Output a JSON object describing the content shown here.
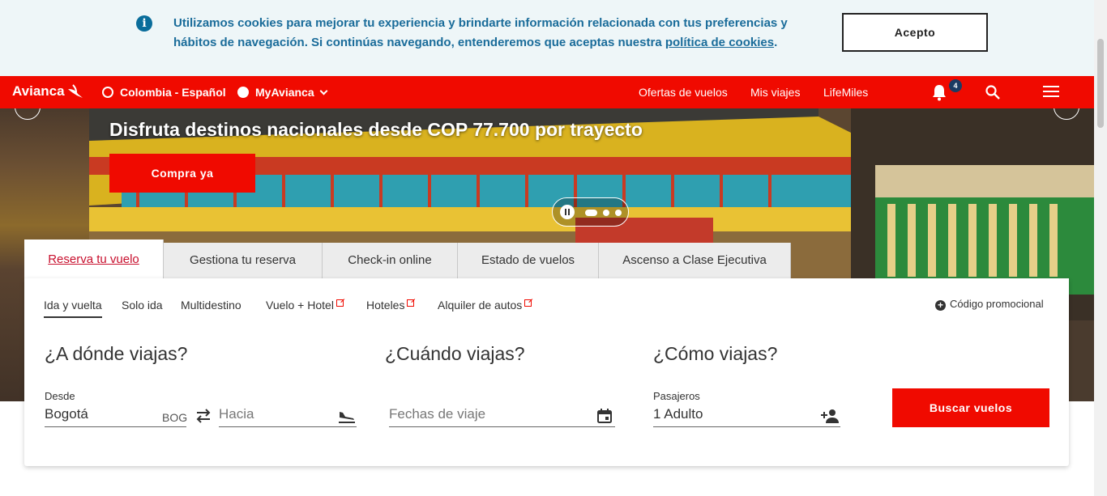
{
  "cookie": {
    "info_icon": "info-icon",
    "message_line1": "Utilizamos cookies para mejorar tu experiencia y brindarte información relacionada con tus preferencias y",
    "message_line2": "hábitos de navegación. Si continúas navegando, entenderemos que aceptas nuestra",
    "policy_link": "política de cookies",
    "period": ".",
    "accept_label": "Acepto"
  },
  "nav": {
    "logo": "Avianca",
    "country": "Colombia - Español",
    "account": "MyAvianca",
    "links": [
      "Ofertas de vuelos",
      "Mis viajes",
      "LifeMiles"
    ],
    "notification_count": "4",
    "brand_color": "#f00a00"
  },
  "hero": {
    "headline": "Disfruta destinos nacionales desde COP 77.700 por trayecto",
    "cta": "Compra ya",
    "slide_count": 3,
    "active_slide": 1
  },
  "tabs": [
    "Reserva tu vuelo",
    "Gestiona tu reserva",
    "Check-in online",
    "Estado de vuelos",
    "Ascenso a Clase Ejecutiva"
  ],
  "booking": {
    "modes": [
      "Ida y vuelta",
      "Solo ida",
      "Multidestino",
      "Vuelo + Hotel",
      "Hoteles",
      "Alquiler de autos"
    ],
    "promo": "Código promocional",
    "where_title": "¿A dónde viajas?",
    "when_title": "¿Cuándo viajas?",
    "how_title": "¿Cómo viajas?",
    "from_label": "Desde",
    "from_value": "Bogotá",
    "from_code": "BOG",
    "to_placeholder": "Hacia",
    "dates_placeholder": "Fechas de viaje",
    "passengers_label": "Pasajeros",
    "passengers_value": "1 Adulto",
    "search_button": "Buscar vuelos"
  }
}
